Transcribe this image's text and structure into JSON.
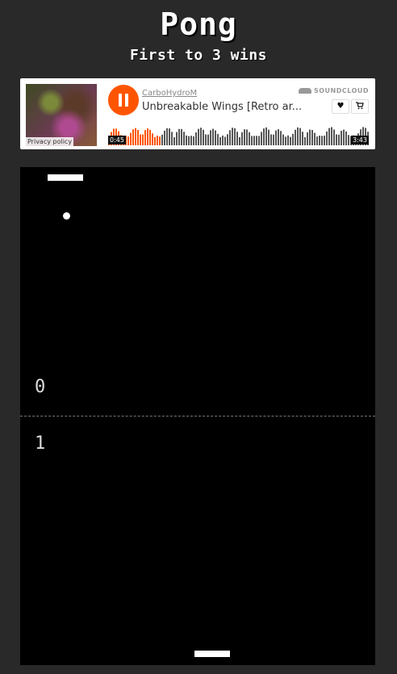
{
  "header": {
    "title": "Pong",
    "subtitle": "First to 3 wins"
  },
  "soundcloud": {
    "privacy": "Privacy policy",
    "user": "CarboHydroM",
    "track": "Unbreakable Wings [Retro ar...",
    "brand": "SOUNDCLOUD",
    "elapsed": "0:45",
    "duration": "3:43",
    "progress": 0.2,
    "accent": "#ff5500",
    "like_icon": "heart-icon",
    "buy_icon": "cart-icon",
    "play_state_icon": "pause-icon"
  },
  "game": {
    "score_top": "0",
    "score_bottom": "1",
    "board_color": "#000000"
  }
}
